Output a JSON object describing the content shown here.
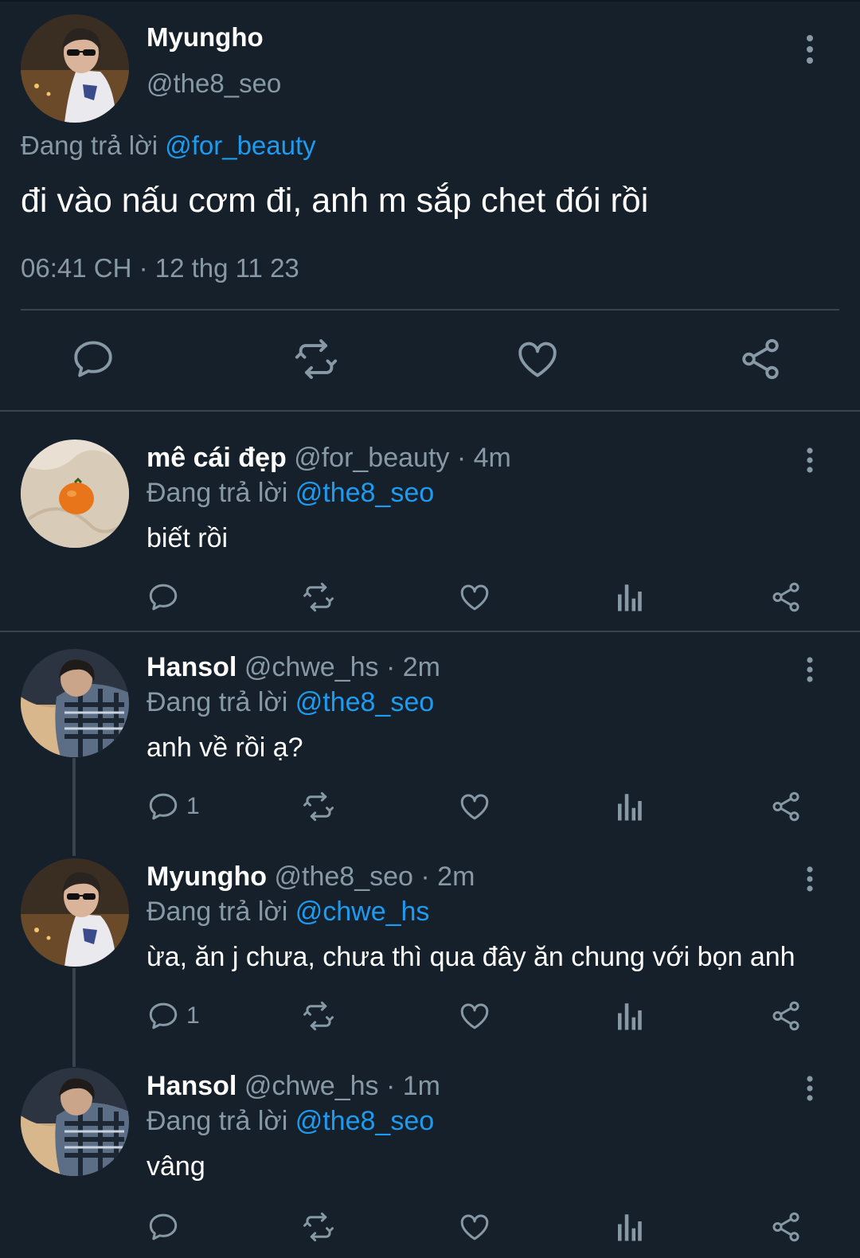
{
  "main_tweet": {
    "author_name": "Myungho",
    "author_handle": "@the8_seo",
    "replying_label": "Đang trả lời",
    "replying_to": "@for_beauty",
    "text": "đi vào nấu cơm đi, anh m sắp chet đói rồi",
    "timestamp": "06:41 CH · 12 thg 11 23",
    "actions": [
      "reply-icon",
      "retweet-icon",
      "like-icon",
      "share-icon"
    ]
  },
  "replies": [
    {
      "name": "mê cái đẹp",
      "handle": "@for_beauty",
      "time": "· 4m",
      "replying_label": "Đang trả lời",
      "replying_to": "@the8_seo",
      "text": "biết rồi",
      "reply_count": ""
    },
    {
      "name": "Hansol",
      "handle": "@chwe_hs",
      "time": "· 2m",
      "replying_label": "Đang trả lời",
      "replying_to": "@the8_seo",
      "text": "anh về rồi ạ?",
      "reply_count": "1"
    },
    {
      "name": "Myungho",
      "handle": "@the8_seo",
      "time": "· 2m",
      "replying_label": "Đang trả lời",
      "replying_to": "@chwe_hs",
      "text": "ừa, ăn j chưa, chưa thì qua đây ăn chung với bọn anh",
      "reply_count": "1"
    },
    {
      "name": "Hansol",
      "handle": "@chwe_hs",
      "time": "· 1m",
      "replying_label": "Đang trả lời",
      "replying_to": "@the8_seo",
      "text": "vâng",
      "reply_count": ""
    }
  ],
  "colors": {
    "background": "#15202b",
    "muted": "#8899a6",
    "link": "#1d9bf0",
    "divider": "#38444d"
  }
}
